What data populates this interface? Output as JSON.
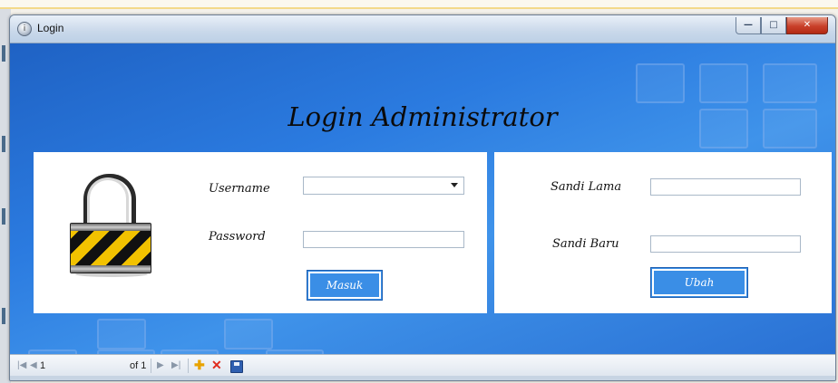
{
  "window": {
    "title": "Login",
    "icon": "app-icon",
    "caption_buttons": [
      "minimize",
      "maximize",
      "close"
    ]
  },
  "heading": "Login Administrator",
  "login_panel": {
    "username_label": "Username",
    "username_value": "",
    "password_label": "Password",
    "password_value": "",
    "submit_label": "Masuk",
    "image": "padlock-icon"
  },
  "change_panel": {
    "old_label": "Sandi Lama",
    "old_value": "",
    "new_label": "Sandi Baru",
    "new_value": "",
    "submit_label": "Ubah"
  },
  "navigator": {
    "position": "1",
    "count_text": "of 1",
    "icons": [
      "move-first-icon",
      "move-previous-icon",
      "move-next-icon",
      "move-last-icon",
      "add-new-icon",
      "delete-icon",
      "save-icon"
    ]
  },
  "colors": {
    "accent": "#3a8ee6",
    "background_blue": "#2b7be0",
    "delete_red": "#e02b1d",
    "add_orange": "#e8a300"
  }
}
